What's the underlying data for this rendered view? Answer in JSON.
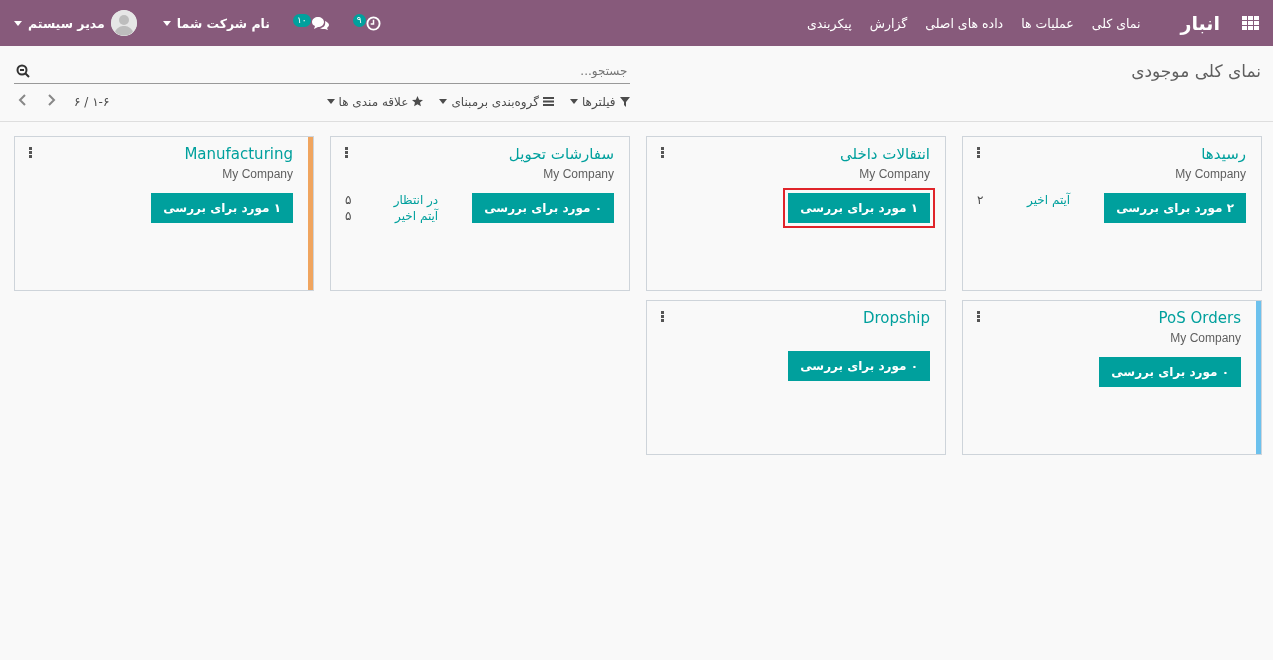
{
  "navbar": {
    "app_name": "انبار",
    "menu": [
      "نمای کلی",
      "عملیات ها",
      "داده های اصلی",
      "گزارش",
      "پیکربندی"
    ],
    "activity_count": "٩",
    "message_count": "١٠",
    "company": "نام شرکت شما",
    "user": "مدیر سیستم"
  },
  "control_panel": {
    "title": "نمای کلی موجودی",
    "search": {
      "placeholder": "جستجو..."
    },
    "filters": [
      "فیلترها",
      "گروه‌بندی برمبنای",
      "علاقه مندی ها"
    ],
    "pager": "۱-۶ / ۶"
  },
  "cards": [
    {
      "title": "رسیدها",
      "company": "My Company",
      "button": "۲ مورد برای بررسی",
      "highlighted": false,
      "stats": [
        {
          "label": "آیتم اخیر",
          "value": "۲"
        }
      ]
    },
    {
      "title": "انتقالات داخلی",
      "company": "My Company",
      "button": "۱ مورد برای بررسی",
      "highlighted": true
    },
    {
      "title": "سفارشات تحویل",
      "company": "My Company",
      "button": "۰ مورد برای بررسی",
      "highlighted": false,
      "stats": [
        {
          "label": "در انتظار",
          "value": "۵"
        },
        {
          "label": "آیتم اخیر",
          "value": "۵"
        }
      ]
    },
    {
      "title": "Manufacturing",
      "company": "My Company",
      "button": "۱ مورد برای بررسی",
      "highlighted": false,
      "color": "#f0a55f"
    },
    {
      "title": "PoS Orders",
      "company": "My Company",
      "button": "۰ مورد برای بررسی",
      "highlighted": false,
      "color": "#6cc1ed"
    },
    {
      "title": "Dropship",
      "button": "۰ مورد برای بررسی",
      "highlighted": false
    }
  ]
}
